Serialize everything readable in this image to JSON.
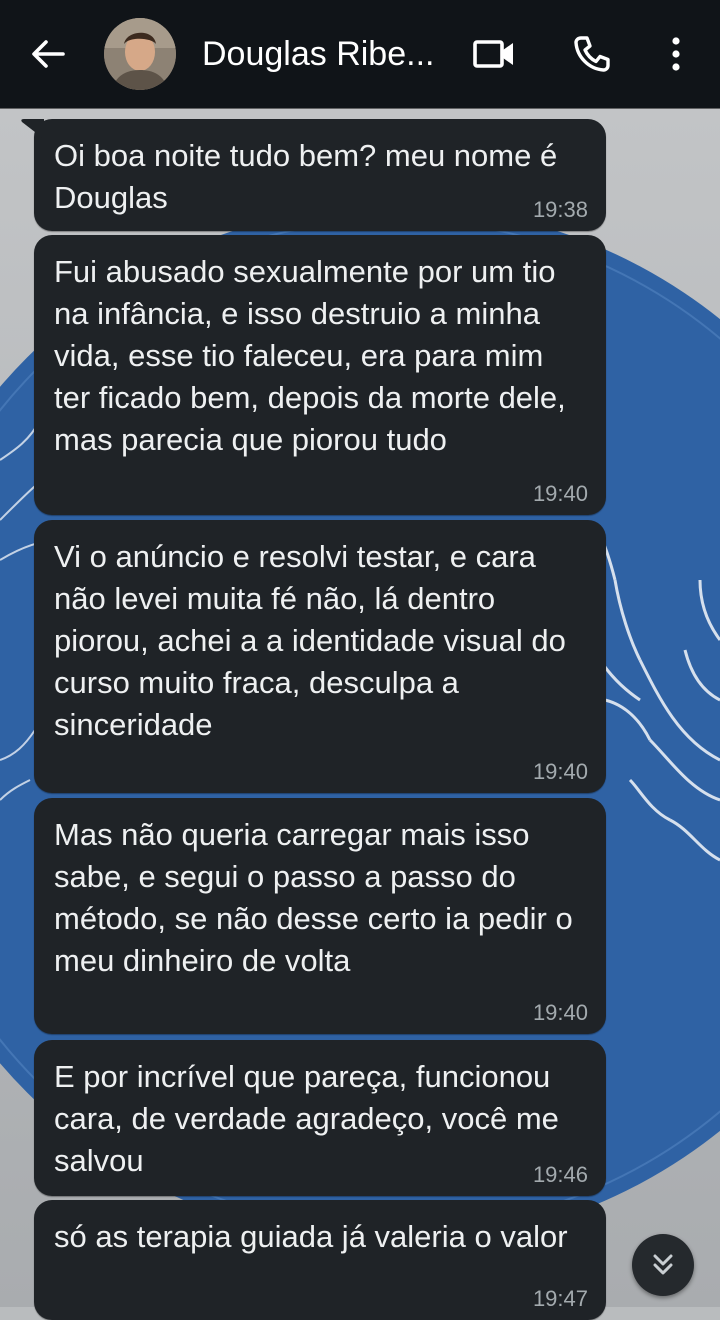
{
  "header": {
    "contact_name": "Douglas Ribe..."
  },
  "messages": [
    {
      "text": "Oi boa noite tudo bem? meu nome é Douglas",
      "time": "19:38"
    },
    {
      "text": "Fui abusado sexualmente por um tio na infância, e isso destruio a minha vida, esse tio faleceu, era para mim ter ficado bem, depois da morte dele, mas parecia que piorou tudo",
      "time": "19:40"
    },
    {
      "text": "Vi o anúncio e resolvi testar, e cara não levei muita fé não, lá dentro piorou, achei a a identidade visual do curso muito fraca, desculpa a sinceridade",
      "time": "19:40"
    },
    {
      "text": "Mas não queria carregar mais isso sabe, e segui o passo a passo do método, se não desse certo ia pedir o meu dinheiro de volta",
      "time": "19:40"
    },
    {
      "text": "E por incrível que pareça, funcionou cara, de verdade agradeço, você me salvou",
      "time": "19:46"
    },
    {
      "text": "só as terapia guiada já valeria o valor",
      "time": "19:47"
    }
  ],
  "colors": {
    "header_bg": "#101418",
    "bubble_bg": "#1f2327",
    "text": "#eef0f1",
    "timestamp": "#a3aaae",
    "wallpaper_blue": "#2f62a4"
  }
}
